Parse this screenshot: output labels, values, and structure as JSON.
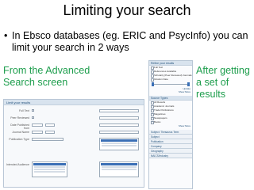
{
  "slide": {
    "title": "Limiting your search",
    "bullet_mark": "•",
    "bullet_text": "In Ebsco databases (eg. ERIC and PsycInfo) you can limit your search in 2 ways",
    "left_label_line1": "From the Advanced",
    "left_label_line2": "Search screen",
    "right_label_line1": "After getting",
    "right_label_line2": "a set of",
    "right_label_line3": "results"
  },
  "advanced_screen": {
    "header": "Limit your results",
    "rows": [
      {
        "label": "Full Text"
      },
      {
        "label": "Peer Reviewed"
      },
      {
        "label": "Date Published from"
      },
      {
        "label": "Journal Name"
      },
      {
        "label": "Publication Type"
      },
      {
        "label": "Intended Audience"
      }
    ]
  },
  "sidebar": {
    "header": "Refine your results",
    "options": [
      "Full Text",
      "References Available",
      "Scholarly (Peer Reviewed) Journals"
    ],
    "date_label": "Publication Date",
    "update_link": "Update",
    "show_more": "Show More",
    "source_header": "Source Types",
    "source_options": [
      "All Results",
      "Academic Journals",
      "Trade Publications",
      "Magazines",
      "Newspapers",
      "Books"
    ],
    "facets": [
      "Subject: Thesaurus Term",
      "Subject",
      "Publication",
      "Company",
      "Geography",
      "NAICS/Industry"
    ]
  },
  "colors": {
    "accent_green": "#1e9e4d",
    "link_blue": "#23527c"
  }
}
